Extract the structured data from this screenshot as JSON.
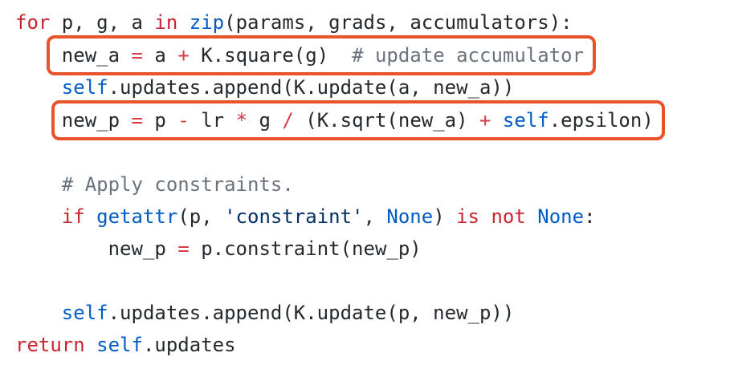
{
  "code": {
    "l1": {
      "kw_for": "for",
      "t1": " p, g, a ",
      "kw_in": "in",
      "t2": " ",
      "fn_zip": "zip",
      "t3": "(params, grads, accumulators):"
    },
    "l2": {
      "indent": "    ",
      "t1": "new_a ",
      "op_eq": "=",
      "t2": " a ",
      "op_plus": "+",
      "t3": " K.square(g)  ",
      "comment": "# update accumulator"
    },
    "l3": {
      "indent": "    ",
      "self": "self",
      "t1": ".updates.append(K.update(a, new_a))"
    },
    "l4": {
      "indent": "    ",
      "t1": "new_p ",
      "op_eq": "=",
      "t2": " p ",
      "op_minus": "-",
      "t3": " lr ",
      "op_mul": "*",
      "t4": " g ",
      "op_div": "/",
      "t5": " (K.sqrt(new_a) ",
      "op_plus": "+",
      "t6": " ",
      "self": "self",
      "t7": ".epsilon)"
    },
    "l6": {
      "indent": "    ",
      "comment": "# Apply constraints."
    },
    "l7": {
      "indent": "    ",
      "kw_if": "if",
      "t1": " ",
      "fn_getattr": "getattr",
      "t2": "(p, ",
      "str": "'constraint'",
      "t3": ", ",
      "none1": "None",
      "t4": ") ",
      "kw_is": "is",
      "t5": " ",
      "kw_not": "not",
      "t6": " ",
      "none2": "None",
      "t7": ":"
    },
    "l8": {
      "indent": "        ",
      "t1": "new_p ",
      "op_eq": "=",
      "t2": " p.constraint(new_p)"
    },
    "l10": {
      "indent": "    ",
      "self": "self",
      "t1": ".updates.append(K.update(p, new_p))"
    },
    "l11": {
      "kw_return": "return",
      "t1": " ",
      "self": "self",
      "t2": ".updates"
    }
  },
  "highlight_color": "#e8532a"
}
